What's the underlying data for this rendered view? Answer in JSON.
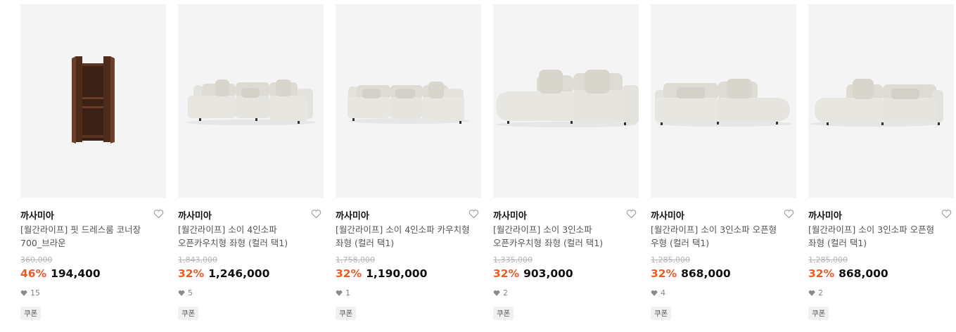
{
  "accent_color": "#ef5a2a",
  "products": [
    {
      "brand": "까사미아",
      "name_line1": "[월간라이프] 핏 드레스룸 코너장",
      "name_line2": "700_브라운",
      "original_price": "360,000",
      "discount": "46%",
      "price": "194,400",
      "likes": "15",
      "coupon": "쿠폰",
      "image": "corner-wardrobe-image",
      "wishlist_icon": "heart-outline-icon",
      "likes_icon": "heart-filled-icon"
    },
    {
      "brand": "까사미아",
      "name_line1": "[월간라이프] 소이 4인소파",
      "name_line2": "오픈카우치형 좌형 (컬러 택1)",
      "original_price": "1,843,000",
      "discount": "32%",
      "price": "1,246,000",
      "likes": "5",
      "coupon": "쿠폰",
      "image": "sofa-image",
      "wishlist_icon": "heart-outline-icon",
      "likes_icon": "heart-filled-icon"
    },
    {
      "brand": "까사미아",
      "name_line1": "[월간라이프] 소이 4인소파 카우치형",
      "name_line2": "좌형 (컬러 택1)",
      "original_price": "1,758,000",
      "discount": "32%",
      "price": "1,190,000",
      "likes": "1",
      "coupon": "쿠폰",
      "image": "sofa-image",
      "wishlist_icon": "heart-outline-icon",
      "likes_icon": "heart-filled-icon"
    },
    {
      "brand": "까사미아",
      "name_line1": "[월간라이프] 소이 3인소파",
      "name_line2": "오픈카우치형 좌형 (컬러 택1)",
      "original_price": "1,335,000",
      "discount": "32%",
      "price": "903,000",
      "likes": "2",
      "coupon": "쿠폰",
      "image": "sofa-image",
      "wishlist_icon": "heart-outline-icon",
      "likes_icon": "heart-filled-icon"
    },
    {
      "brand": "까사미아",
      "name_line1": "[월간라이프] 소이 3인소파 오픈형",
      "name_line2": "우형 (컬러 택1)",
      "original_price": "1,285,000",
      "discount": "32%",
      "price": "868,000",
      "likes": "4",
      "coupon": "쿠폰",
      "image": "sofa-image",
      "wishlist_icon": "heart-outline-icon",
      "likes_icon": "heart-filled-icon"
    },
    {
      "brand": "까사미아",
      "name_line1": "[월간라이프] 소이 3인소파 오픈형",
      "name_line2": "좌형 (컬러 택1)",
      "original_price": "1,285,000",
      "discount": "32%",
      "price": "868,000",
      "likes": "2",
      "coupon": "쿠폰",
      "image": "sofa-image",
      "wishlist_icon": "heart-outline-icon",
      "likes_icon": "heart-filled-icon"
    }
  ]
}
